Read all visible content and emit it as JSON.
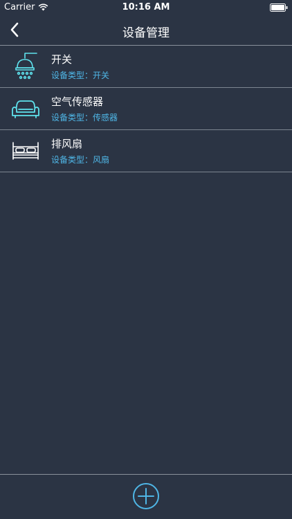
{
  "status_bar": {
    "carrier": "Carrier",
    "time": "10:16 AM"
  },
  "nav": {
    "title": "设备管理"
  },
  "devices": [
    {
      "name": "开关",
      "type_label": "设备类型：",
      "type_value": "开关",
      "icon": "shower-lamp-icon"
    },
    {
      "name": "空气传感器",
      "type_label": "设备类型：",
      "type_value": "传感器",
      "icon": "sofa-icon"
    },
    {
      "name": "排风扇",
      "type_label": "设备类型：",
      "type_value": "风扇",
      "icon": "bed-icon"
    }
  ],
  "colors": {
    "background": "#2b3444",
    "accent": "#4fb6e6",
    "icon_glow": "#5fe3ee"
  }
}
